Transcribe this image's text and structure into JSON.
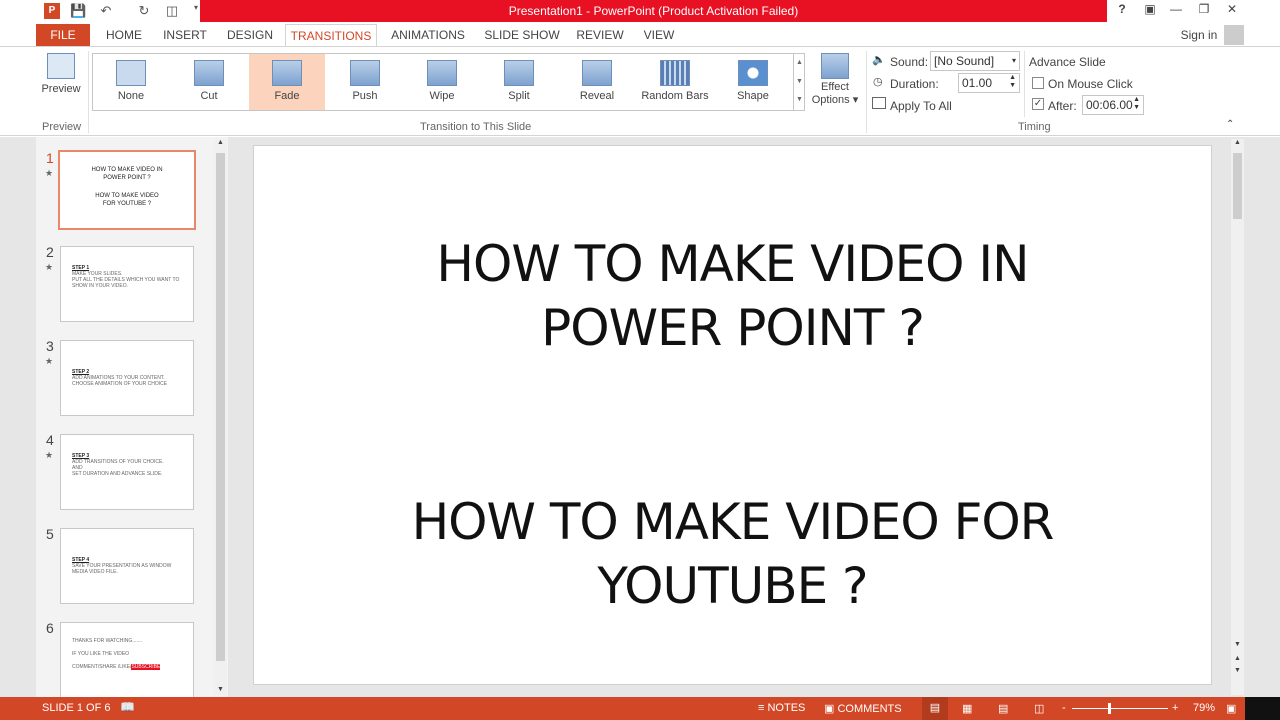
{
  "titlebar": {
    "title": "Presentation1 - PowerPoint (Product Activation Failed)",
    "help": "?",
    "sign_in": "Sign in"
  },
  "tabs": [
    "FILE",
    "HOME",
    "INSERT",
    "DESIGN",
    "TRANSITIONS",
    "ANIMATIONS",
    "SLIDE SHOW",
    "REVIEW",
    "VIEW"
  ],
  "active_tab": "TRANSITIONS",
  "ribbon": {
    "preview": {
      "label": "Preview",
      "group": "Preview"
    },
    "transitions": [
      {
        "label": "None"
      },
      {
        "label": "Cut"
      },
      {
        "label": "Fade",
        "selected": true
      },
      {
        "label": "Push"
      },
      {
        "label": "Wipe"
      },
      {
        "label": "Split"
      },
      {
        "label": "Reveal"
      },
      {
        "label": "Random Bars"
      },
      {
        "label": "Shape"
      }
    ],
    "effect_options": {
      "line1": "Effect",
      "line2": "Options"
    },
    "transition_group": "Transition to This Slide",
    "timing": {
      "sound_label": "Sound:",
      "sound_value": "[No Sound]",
      "duration_label": "Duration:",
      "duration_value": "01.00",
      "apply_all": "Apply To All",
      "advance_title": "Advance Slide",
      "on_mouse_click": "On Mouse Click",
      "on_mouse_click_checked": false,
      "after_label": "After:",
      "after_checked": true,
      "after_value": "00:06.00",
      "group": "Timing"
    }
  },
  "slides": [
    {
      "num": "1",
      "star": true,
      "lines": [
        "HOW TO MAKE VIDEO IN POWER POINT ?",
        "HOW TO MAKE VIDEO FOR YOUTUBE ?"
      ]
    },
    {
      "num": "2",
      "star": true,
      "heading": "STEP 1",
      "lines": [
        "MAKE YOUR SLIDES.",
        "PUT ALL THE DETAILS WHICH YOU WANT TO",
        "SHOW IN YOUR VIDEO."
      ]
    },
    {
      "num": "3",
      "star": true,
      "heading": "STEP 2",
      "lines": [
        "ADD ANIMATIONS TO YOUR CONTENT.",
        "CHOOSE ANIMATION OF YOUR CHOICE"
      ]
    },
    {
      "num": "4",
      "star": true,
      "heading": "STEP 3",
      "lines": [
        "ADD TRANSITIONS OF YOUR CHOICE.",
        "AND",
        "SET DURATION AND ADVANCE SLIDE."
      ]
    },
    {
      "num": "5",
      "star": false,
      "heading": "STEP 4",
      "lines": [
        "SAVE YOUR PRESENTATION AS WINDOW",
        "MEDIA VIDEO FILE."
      ]
    },
    {
      "num": "6",
      "star": false,
      "lines": [
        "THANKS FOR WATCHING.......",
        "IF YOU LIKE THE VIDEO",
        "COMMENT/SHARE /LIKE/"
      ],
      "highlight": "SUBSCRIBE"
    }
  ],
  "main_slide": {
    "title1": "HOW TO MAKE VIDEO IN",
    "title2": "POWER POINT ?",
    "sub1": "HOW TO MAKE VIDEO FOR",
    "sub2": "YOUTUBE ?"
  },
  "status": {
    "slide_info": "SLIDE 1 OF 6",
    "notes": "NOTES",
    "comments": "COMMENTS",
    "zoom": "79%",
    "zoom_minus": "-",
    "zoom_plus": "+"
  },
  "colors": {
    "accent": "#d24726",
    "title_red": "#e81123",
    "selected_transition": "#fcd3bd"
  }
}
